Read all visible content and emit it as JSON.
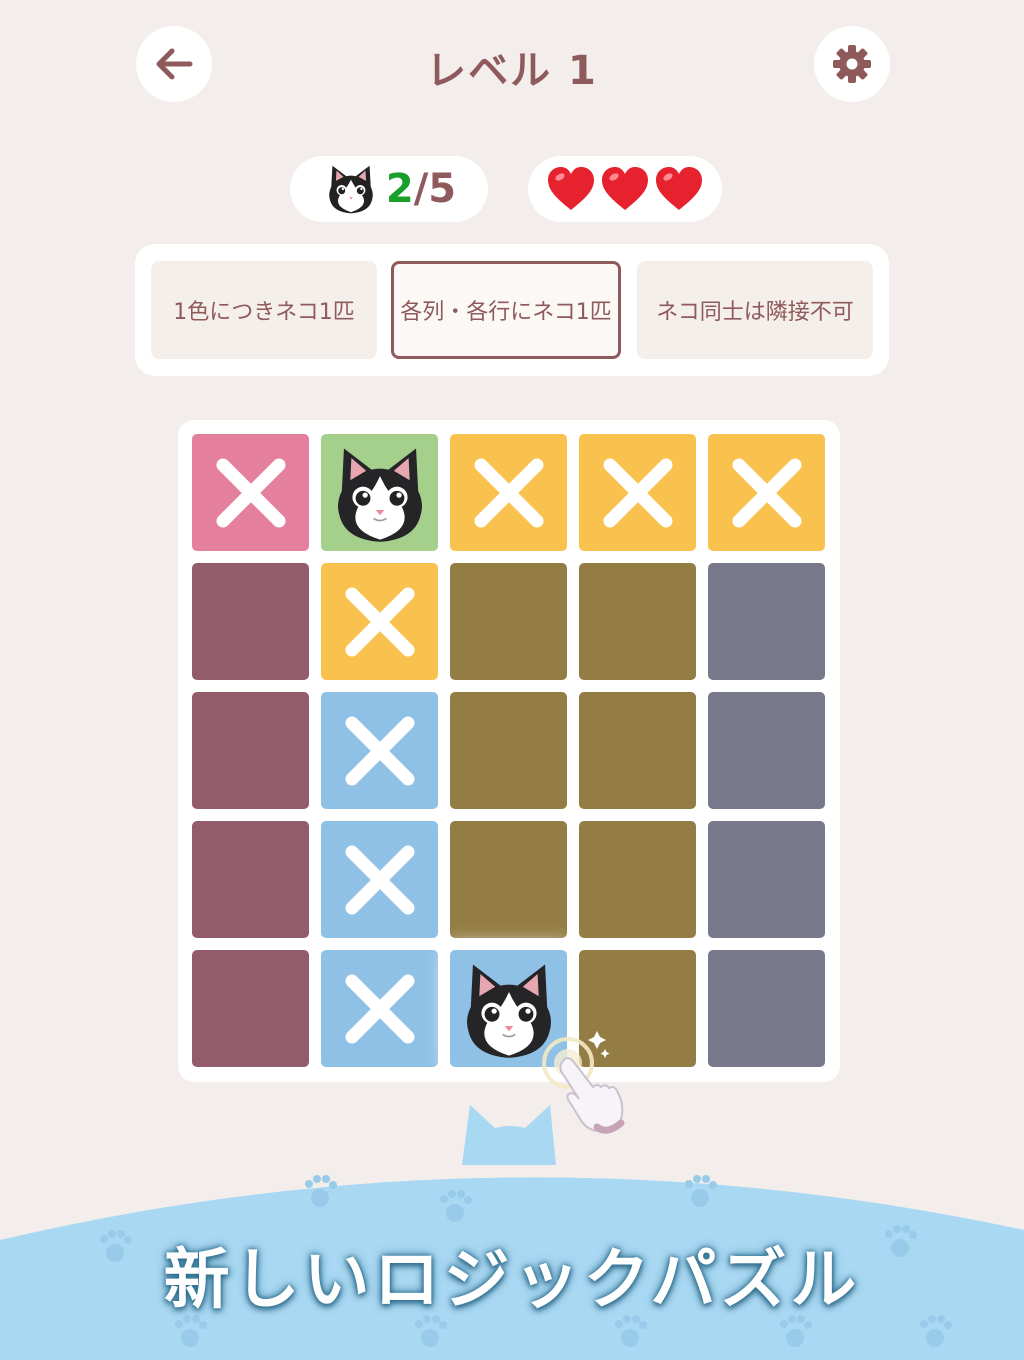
{
  "header": {
    "title": "レベル 1",
    "back_icon": "arrow-left-icon",
    "settings_icon": "gear-icon"
  },
  "status": {
    "cats_found": "2",
    "cats_sep": "/",
    "cats_total": "5",
    "lives": 3
  },
  "rules": [
    {
      "label": "1色につきネコ1匹",
      "active": false
    },
    {
      "label": "各列・各行にネコ1匹",
      "active": true
    },
    {
      "label": "ネコ同士は隣接不可",
      "active": false
    }
  ],
  "colors": {
    "pink": "#e47f9d",
    "green": "#a4d08c",
    "yellow": "#f9c24e",
    "blue": "#8fc0e5",
    "maroon": "#925c6b",
    "olive": "#947d44",
    "slate": "#78788b",
    "accent": "#8f5a5c"
  },
  "grid": [
    [
      "pink:x",
      "green:cat",
      "yellow:x",
      "yellow:x",
      "yellow:x"
    ],
    [
      "maroon:",
      "yellow:x",
      "olive:",
      "olive:",
      "slate:"
    ],
    [
      "maroon:",
      "blue:x",
      "olive:",
      "olive:",
      "slate:"
    ],
    [
      "maroon:",
      "blue:x",
      "olive:",
      "olive:",
      "slate:"
    ],
    [
      "maroon:",
      "blue:x",
      "blue:cat",
      "olive:",
      "slate:"
    ]
  ],
  "tagline": "新しいロジックパズル"
}
